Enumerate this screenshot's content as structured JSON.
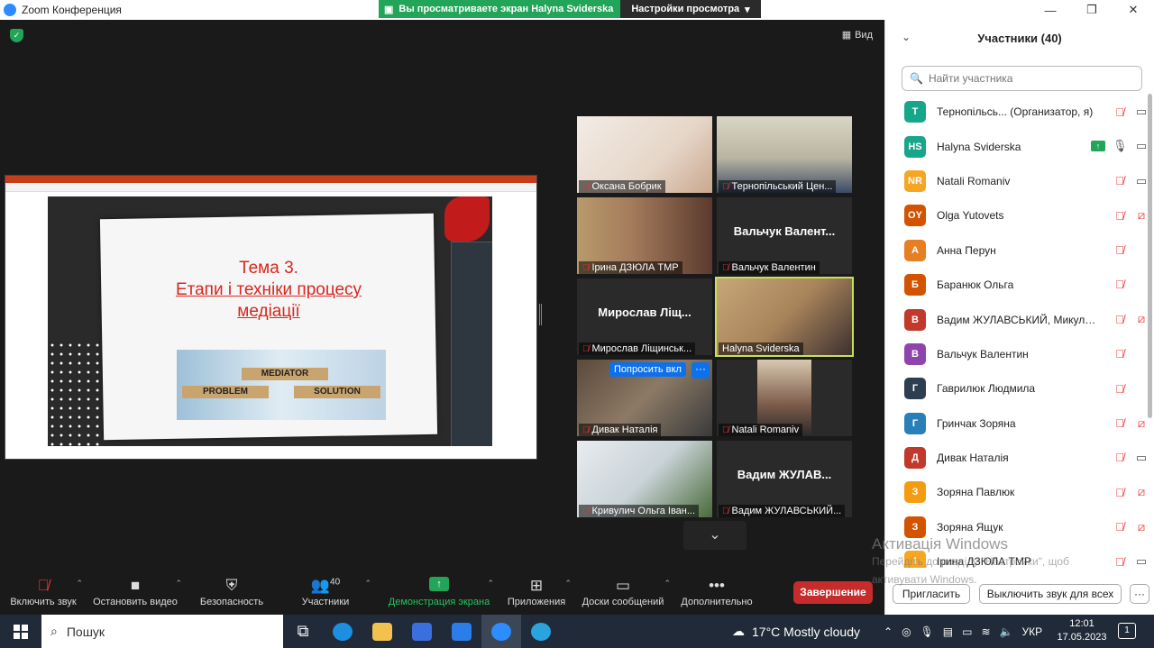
{
  "window": {
    "title": "Zoom Конференция",
    "minimize": "—",
    "maximize": "❐",
    "close": "✕"
  },
  "share_banner": {
    "text": "Вы просматриваете экран Halyna Sviderska",
    "options": "Настройки просмотра",
    "options_arrow": "▾"
  },
  "video": {
    "view_label": "Вид"
  },
  "slide": {
    "line1": "Тема 3.",
    "line2": "Етапи і техніки процесу",
    "line3": "медіації",
    "block_mediator": "MEDIATOR",
    "block_problem": "PROBLEM",
    "block_solution": "SOLUTION"
  },
  "gallery": {
    "tiles": [
      {
        "name": "Оксана Бобрик",
        "big": ""
      },
      {
        "name": "Тернопільський Цен...",
        "big": ""
      },
      {
        "name": "Ірина ДЗЮЛА ТМР",
        "big": ""
      },
      {
        "name": "Вальчук Валентин",
        "big": "Вальчук  Валент..."
      },
      {
        "name": "Мирослав Ліщинськ...",
        "big": "Мирослав  Ліщ..."
      },
      {
        "name": "Halyna Sviderska",
        "big": ""
      },
      {
        "name": "Дивак Наталія",
        "big": ""
      },
      {
        "name": "Natali Romaniv",
        "big": ""
      },
      {
        "name": "Кривулич Ольга Іван...",
        "big": ""
      },
      {
        "name": "Вадим ЖУЛАВСЬКИЙ...",
        "big": "Вадим  ЖУЛАВ..."
      }
    ],
    "request_label": "Попросить вкл",
    "more_label": "···",
    "scroll_down": "⌄"
  },
  "toolbar": {
    "unmute": "Включить звук",
    "stop_video": "Остановить видео",
    "security": "Безопасность",
    "participants": "Участники",
    "participants_count": "40",
    "share_screen": "Демонстрация экрана",
    "apps": "Приложения",
    "whiteboards": "Доски сообщений",
    "more": "Дополнительно",
    "end": "Завершение"
  },
  "panel": {
    "title": "Участники (40)",
    "search_placeholder": "Найти участника",
    "participants": [
      {
        "initials": "T",
        "color": "#17a68a",
        "name": "Тернопільсь...  (Организатор, я)",
        "mic": "muted",
        "cam": "on"
      },
      {
        "initials": "HS",
        "color": "#17a68a",
        "name": "Halyna Sviderska",
        "mic": "on",
        "cam": "on",
        "sharing": true
      },
      {
        "initials": "NR",
        "color": "#f5a623",
        "name": "Natali Romaniv",
        "mic": "muted",
        "cam": "on"
      },
      {
        "initials": "OY",
        "color": "#d35400",
        "name": "Olga Yutovets",
        "mic": "muted",
        "cam": "off"
      },
      {
        "initials": "А",
        "color": "#e67e22",
        "name": "Анна Перун",
        "mic": "muted",
        "cam": "none"
      },
      {
        "initials": "Б",
        "color": "#d35400",
        "name": "Баранюк Ольга",
        "mic": "muted",
        "cam": "none"
      },
      {
        "initials": "В",
        "color": "#c0392b",
        "name": "Вадим ЖУЛАВСЬКИЙ, Микули...",
        "mic": "muted",
        "cam": "off"
      },
      {
        "initials": "В",
        "color": "#8e44ad",
        "name": "Вальчук Валентин",
        "mic": "muted",
        "cam": "none"
      },
      {
        "initials": "Г",
        "color": "#2c3e50",
        "name": "Гаврилюк Людмила",
        "mic": "muted",
        "cam": "none"
      },
      {
        "initials": "Г",
        "color": "#2980b9",
        "name": "Гринчак Зоряна",
        "mic": "muted",
        "cam": "off"
      },
      {
        "initials": "Д",
        "color": "#c0392b",
        "name": "Дивак Наталія",
        "mic": "muted",
        "cam": "on"
      },
      {
        "initials": "З",
        "color": "#f39c12",
        "name": "Зоряна Павлюк",
        "mic": "muted",
        "cam": "off"
      },
      {
        "initials": "З",
        "color": "#d35400",
        "name": "Зоряна Ящук",
        "mic": "muted",
        "cam": "off"
      },
      {
        "initials": "І",
        "color": "#f5a623",
        "name": "Ірина ДЗЮЛА ТМР",
        "mic": "muted",
        "cam": "on"
      }
    ],
    "invite": "Пригласить",
    "mute_all": "Выключить звук для всех",
    "more": "···"
  },
  "watermark": {
    "title": "Активація Windows",
    "line2": "Перейдіть до розділу \"Настройки\", щоб",
    "line3": "активувати Windows."
  },
  "taskbar": {
    "search": "Пошук",
    "weather": "17°C  Mostly cloudy",
    "lang": "УКР",
    "time": "12:01",
    "date": "17.05.2023",
    "notifications": "1"
  },
  "colors": {
    "accent_green": "#23a559",
    "end_red": "#c72c2c",
    "muted_red": "#e33333",
    "zoom_blue": "#0e71eb"
  }
}
